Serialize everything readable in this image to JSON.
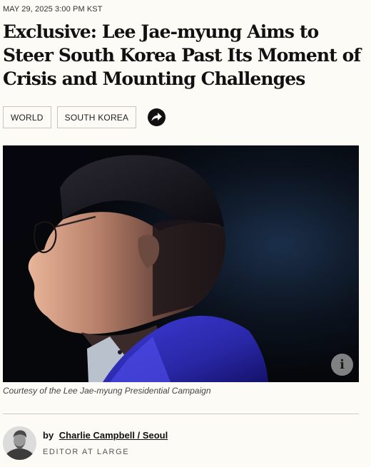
{
  "article": {
    "timestamp": "MAY 29, 2025 3:00 PM KST",
    "headline": "Exclusive: Lee Jae-myung Aims to Steer South Korea Past Its Moment of Crisis and Mounting Challenges",
    "tags": [
      "WORLD",
      "SOUTH KOREA"
    ],
    "share_icon": "share-arrow-icon",
    "image": {
      "alt": "Lee Jae-myung in profile against a dark background",
      "caption": "Courtesy of the Lee Jae-myung Presidential Campaign",
      "info_glyph": "i"
    },
    "author": {
      "by_label": "by",
      "name": "Charlie Campbell / Seoul",
      "role": "EDITOR AT LARGE"
    }
  },
  "colors": {
    "background": "#fdfbf6",
    "text": "#111111",
    "tag_border": "#c9c5bd",
    "share_button": "#111111",
    "info_button": "#969696"
  }
}
